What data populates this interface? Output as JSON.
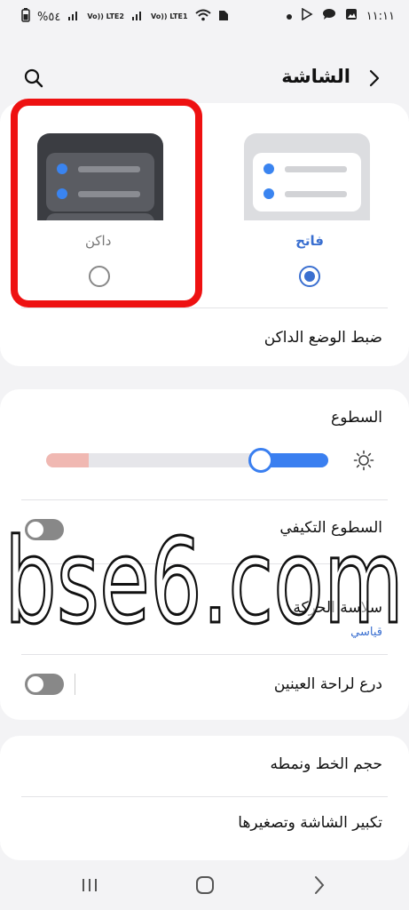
{
  "status_bar": {
    "time": "١١:١١",
    "battery": "%٥٤",
    "sim1": "Vo)) LTE2",
    "sim2": "Vo)) LTE1"
  },
  "header": {
    "title": "الشاشة"
  },
  "theme": {
    "light_label": "فاتح",
    "dark_label": "داكن",
    "selected": "light"
  },
  "dark_mode_settings": "ضبط الوضع الداكن",
  "brightness": {
    "label": "السطوع",
    "level": 0.76
  },
  "adaptive_brightness": {
    "label": "السطوع التكيفي",
    "enabled": false
  },
  "motion_smoothness": {
    "label": "سلاسة الحركة",
    "value": "قياسي"
  },
  "eye_comfort": {
    "label": "درع لراحة العينين",
    "enabled": false
  },
  "font_size_style": "حجم الخط ونمطه",
  "screen_zoom": "تكبير الشاشة وتصغيرها",
  "watermark": "bse6.com",
  "colors": {
    "accent": "#3a6fd0",
    "highlight": "#ee1111"
  }
}
